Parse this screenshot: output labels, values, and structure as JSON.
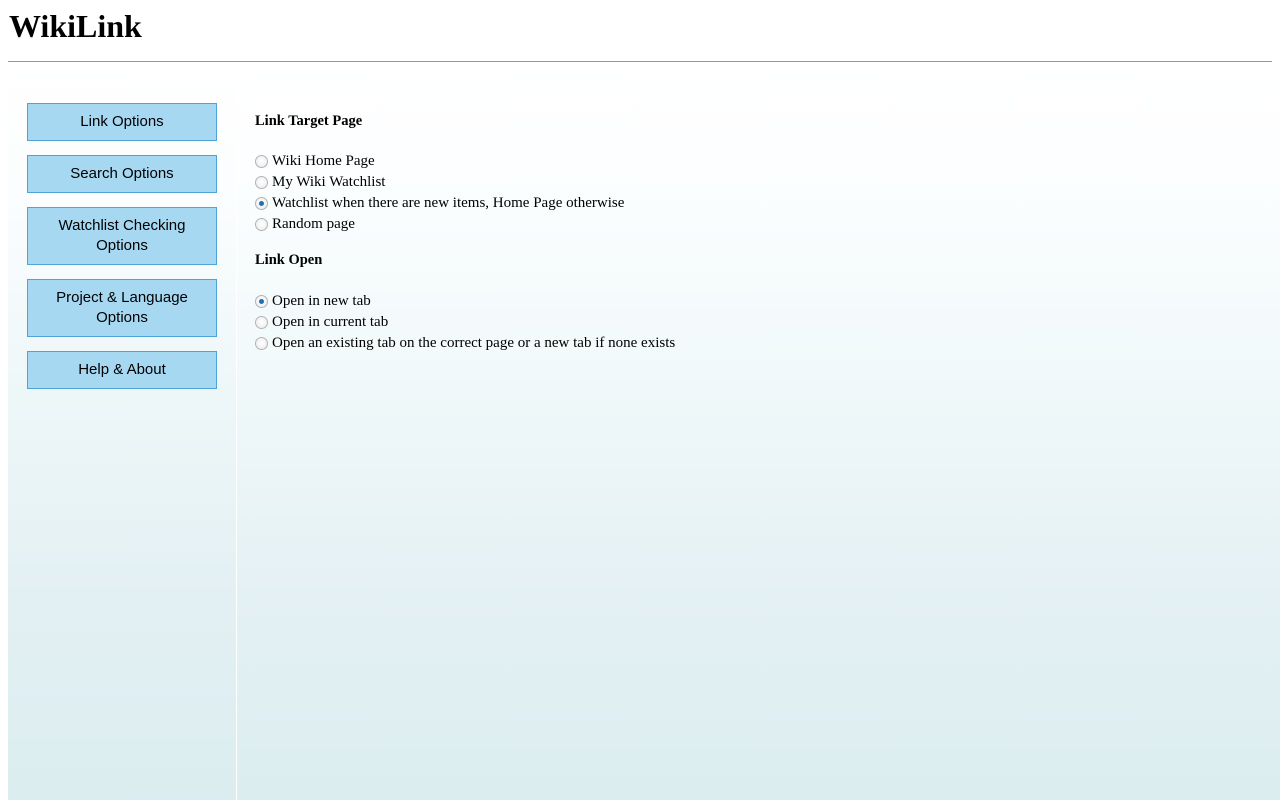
{
  "header": {
    "app_title": "WikiLink"
  },
  "sidebar": {
    "items": [
      {
        "label": "Link Options",
        "name": "link-options"
      },
      {
        "label": "Search Options",
        "name": "search-options"
      },
      {
        "label": "Watchlist Checking Options",
        "name": "watchlist-checking-options"
      },
      {
        "label": "Project & Language Options",
        "name": "project-language-options"
      },
      {
        "label": "Help & About",
        "name": "help-about"
      }
    ]
  },
  "main": {
    "groups": [
      {
        "title": "Link Target Page",
        "options": [
          {
            "label": "Wiki Home Page",
            "checked": false
          },
          {
            "label": "My Wiki Watchlist",
            "checked": false
          },
          {
            "label": "Watchlist when there are new items, Home Page otherwise",
            "checked": true
          },
          {
            "label": "Random page",
            "checked": false
          }
        ]
      },
      {
        "title": "Link Open",
        "options": [
          {
            "label": "Open in new tab",
            "checked": true
          },
          {
            "label": "Open in current tab",
            "checked": false
          },
          {
            "label": "Open an existing tab on the correct page or a new tab if none exists",
            "checked": false
          }
        ]
      }
    ]
  },
  "colors": {
    "button_fill": "#a6d8f2",
    "button_border": "#4ea4d8",
    "panel_gradient_bottom": "#dbedf0",
    "radio_dot": "#1c6fb8",
    "rule": "#999999"
  }
}
